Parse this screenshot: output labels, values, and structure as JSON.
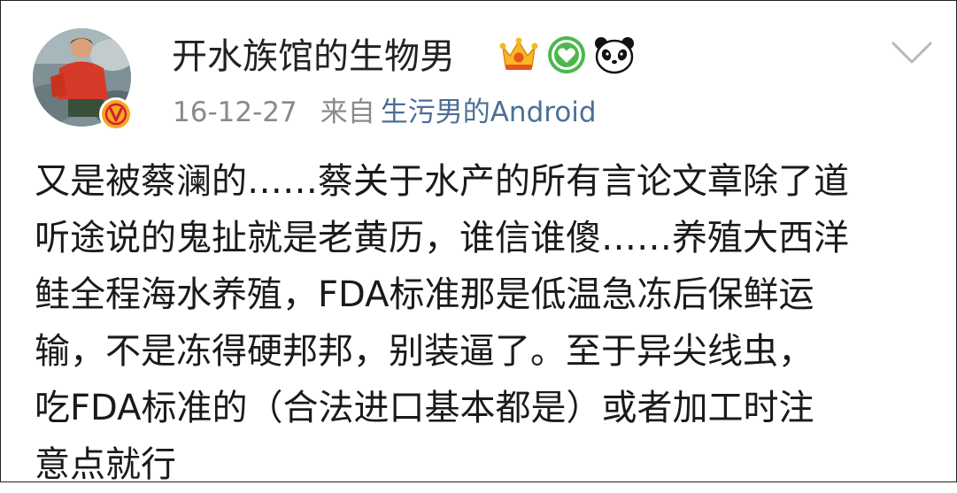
{
  "post": {
    "author": "开水族馆的生物男",
    "date": "16-12-27",
    "from_label": "来自",
    "source": "生污男的Android",
    "content_lines": [
      "又是被蔡澜的……蔡关于水产的所有言论文章除了道",
      "听途说的鬼扯就是老黄历，谁信谁傻……养殖大西洋",
      "鲑全程海水养殖，FDA标准那是低温急冻后保鲜运",
      "输，不是冻得硬邦邦，别装逼了。至于异尖线虫，",
      "吃FDA标准的（合法进口基本都是）或者加工时注",
      "意点就行"
    ]
  },
  "icons": {
    "verified": "verified-v-icon",
    "crown": "crown-icon",
    "heart": "green-heart-icon",
    "panda": "panda-icon",
    "more": "chevron-down-icon"
  },
  "colors": {
    "link": "#4b6f96",
    "verified": "#f5a623",
    "meta": "#8a8a8a"
  }
}
